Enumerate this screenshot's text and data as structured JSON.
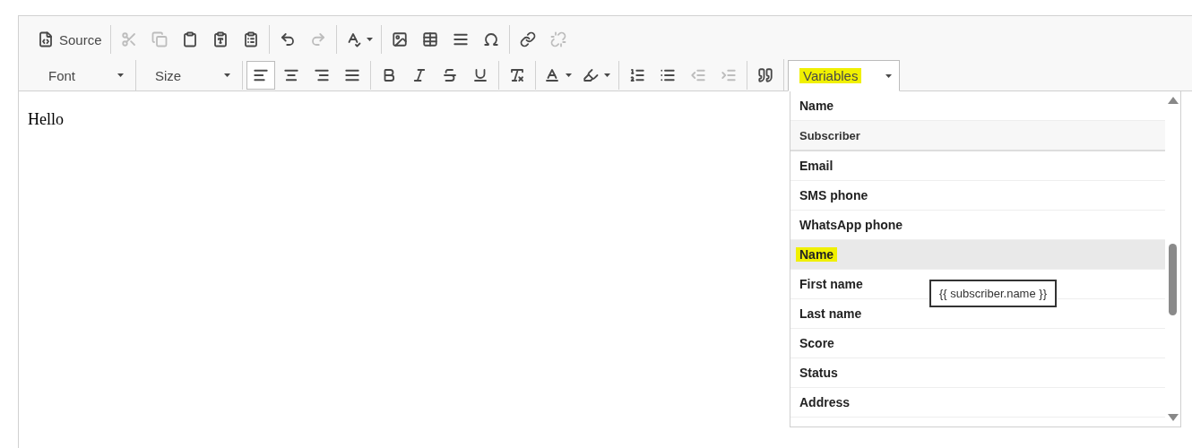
{
  "toolbar": {
    "rows": [
      {
        "groups": [
          {
            "buttons": [
              {
                "kind": "button",
                "label": "Source",
                "disabled": false
              }
            ]
          },
          {
            "buttons": [
              {
                "kind": "button",
                "disabled": true
              },
              {
                "kind": "button",
                "disabled": true
              },
              {
                "kind": "button",
                "disabled": false
              },
              {
                "kind": "button",
                "disabled": false
              },
              {
                "kind": "button",
                "disabled": false
              }
            ]
          },
          {
            "buttons": [
              {
                "kind": "button",
                "disabled": false
              },
              {
                "kind": "button",
                "disabled": true
              }
            ]
          },
          {
            "buttons": [
              {
                "kind": "menu",
                "disabled": false
              }
            ]
          },
          {
            "buttons": [
              {
                "kind": "button",
                "disabled": false
              },
              {
                "kind": "button",
                "disabled": false
              },
              {
                "kind": "button",
                "disabled": false
              },
              {
                "kind": "button",
                "disabled": false
              }
            ]
          },
          {
            "buttons": [
              {
                "kind": "button",
                "disabled": false
              },
              {
                "kind": "button",
                "disabled": true
              }
            ]
          }
        ]
      },
      {
        "groups": [
          {
            "buttons": [
              {
                "kind": "combo",
                "label": "Font",
                "marked": false
              }
            ]
          },
          {
            "buttons": [
              {
                "kind": "combo",
                "label": "Size",
                "marked": false
              }
            ]
          },
          {
            "buttons": [
              {
                "kind": "button",
                "disabled": false,
                "selected": true
              },
              {
                "kind": "button",
                "disabled": false,
                "selected": false
              },
              {
                "kind": "button",
                "disabled": false,
                "selected": false
              },
              {
                "kind": "button",
                "disabled": false,
                "selected": false
              }
            ]
          },
          {
            "buttons": [
              {
                "kind": "button",
                "disabled": false
              },
              {
                "kind": "button",
                "disabled": false
              },
              {
                "kind": "button",
                "disabled": false
              },
              {
                "kind": "button",
                "disabled": false
              }
            ]
          },
          {
            "buttons": [
              {
                "kind": "button",
                "disabled": false
              }
            ]
          },
          {
            "buttons": [
              {
                "kind": "menu",
                "disabled": false
              },
              {
                "kind": "menu",
                "disabled": false
              }
            ]
          },
          {
            "buttons": [
              {
                "kind": "button",
                "disabled": false
              },
              {
                "kind": "button",
                "disabled": false
              },
              {
                "kind": "button",
                "disabled": true
              },
              {
                "kind": "button",
                "disabled": true
              }
            ]
          },
          {
            "buttons": [
              {
                "kind": "button",
                "disabled": false
              }
            ]
          },
          {
            "buttons": [
              {
                "kind": "combo",
                "label": "Variables",
                "marked": true,
                "open": true
              }
            ]
          }
        ]
      }
    ]
  },
  "content": "Hello",
  "variables_menu": {
    "items": [
      {
        "kind": "item",
        "label": "Name",
        "hovered": false,
        "marked": false
      },
      {
        "kind": "group",
        "label": "Subscriber"
      },
      {
        "kind": "item",
        "label": "Email",
        "hovered": false,
        "marked": false
      },
      {
        "kind": "item",
        "label": "SMS phone",
        "hovered": false,
        "marked": false
      },
      {
        "kind": "item",
        "label": "WhatsApp phone",
        "hovered": false,
        "marked": false
      },
      {
        "kind": "item",
        "label": "Name",
        "hovered": true,
        "marked": true
      },
      {
        "kind": "item",
        "label": "First name",
        "hovered": false,
        "marked": false
      },
      {
        "kind": "item",
        "label": "Last name",
        "hovered": false,
        "marked": false
      },
      {
        "kind": "item",
        "label": "Score",
        "hovered": false,
        "marked": false
      },
      {
        "kind": "item",
        "label": "Status",
        "hovered": false,
        "marked": false
      },
      {
        "kind": "item",
        "label": "Address",
        "hovered": false,
        "marked": false
      }
    ],
    "tooltip": "{{ subscriber.name }}"
  }
}
